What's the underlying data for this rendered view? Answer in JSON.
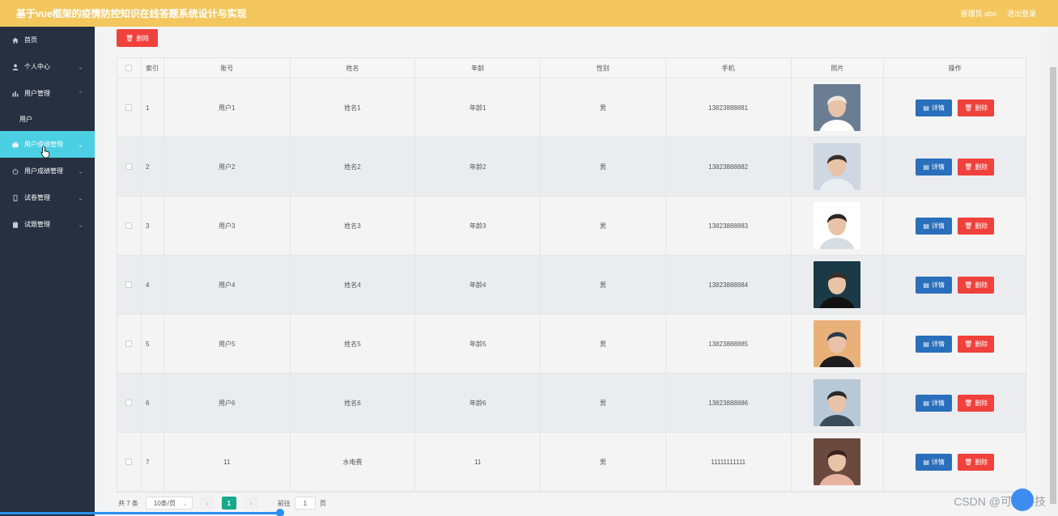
{
  "header": {
    "title": "基于vue框架的疫情防控知识在线答题系统设计与实现",
    "admin_label": "管理员 abo",
    "logout_label": "退出登录"
  },
  "sidebar": {
    "items": [
      {
        "label": "首页",
        "icon": "home-icon",
        "chevron": ""
      },
      {
        "label": "个人中心",
        "icon": "user-icon",
        "chevron": "⌄"
      },
      {
        "label": "用户管理",
        "icon": "chart-icon",
        "chevron": "⌃"
      },
      {
        "label": "用户",
        "icon": "",
        "chevron": ""
      },
      {
        "label": "用户成绩管理",
        "icon": "briefcase-icon",
        "chevron": "⌄"
      },
      {
        "label": "用户成绩管理",
        "icon": "power-icon",
        "chevron": "⌄"
      },
      {
        "label": "试卷管理",
        "icon": "phone-icon",
        "chevron": "⌄"
      },
      {
        "label": "试题管理",
        "icon": "clipboard-icon",
        "chevron": "⌄"
      }
    ]
  },
  "toolbar": {
    "delete_label": "删除"
  },
  "table": {
    "columns": [
      "",
      "索引",
      "账号",
      "姓名",
      "年龄",
      "性别",
      "手机",
      "照片",
      "操作"
    ],
    "rows": [
      {
        "index": "1",
        "account": "用户1",
        "name": "姓名1",
        "age": "年龄1",
        "sex": "男",
        "phone": "13823888881"
      },
      {
        "index": "2",
        "account": "用户2",
        "name": "姓名2",
        "age": "年龄2",
        "sex": "男",
        "phone": "13823888882"
      },
      {
        "index": "3",
        "account": "用户3",
        "name": "姓名3",
        "age": "年龄3",
        "sex": "男",
        "phone": "13823888883"
      },
      {
        "index": "4",
        "account": "用户4",
        "name": "姓名4",
        "age": "年龄4",
        "sex": "男",
        "phone": "13823888884"
      },
      {
        "index": "5",
        "account": "用户5",
        "name": "姓名5",
        "age": "年龄5",
        "sex": "男",
        "phone": "13823888885"
      },
      {
        "index": "6",
        "account": "用户6",
        "name": "姓名6",
        "age": "年龄6",
        "sex": "男",
        "phone": "13823888886"
      },
      {
        "index": "7",
        "account": "11",
        "name": "水电费",
        "age": "11",
        "sex": "男",
        "phone": "11111111111"
      }
    ],
    "detail_label": "详情",
    "delete_label": "删除"
  },
  "pagination": {
    "total_label": "共 7 条",
    "page_size": "10条/页",
    "current_page": "1",
    "goto_label": "前往",
    "goto_value": "1",
    "page_suffix": "页"
  },
  "watermark": "CSDN @可洛科技",
  "colors": {
    "header_bg": "#f4c75e",
    "sidebar_bg": "#263040",
    "active_menu": "#4bcfe3",
    "danger": "#f0413c",
    "primary": "#2a6fbb",
    "pager_active": "#17a98b"
  }
}
